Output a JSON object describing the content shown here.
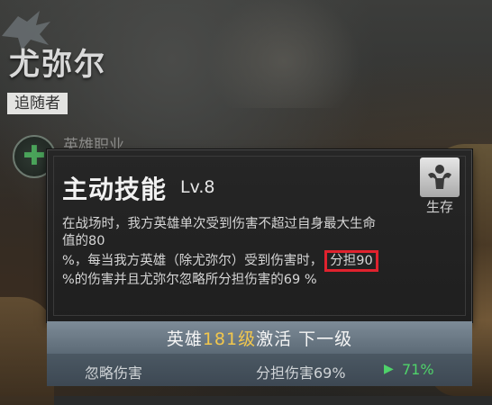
{
  "hero": {
    "name": "尤弥尔",
    "role": "追随者",
    "class_label": "英雄职业",
    "class_icon": "plus-icon"
  },
  "skill": {
    "title": "主动技能",
    "level": "Lv.8",
    "type_label": "生存",
    "type_icon": "muscle-icon",
    "description": {
      "line1": "在战场时，我方英雄单次受到伤害不超过自身最大生命",
      "line2": "值的80",
      "line3a": "%，每当我方英雄（除尤弥尔）受到伤害时，",
      "line3b": "分担90",
      "line4": "%的伤害并且尤弥尔忽略所分担伤害的69 %"
    }
  },
  "activation": {
    "prefix": "英雄",
    "level": "181级",
    "suffix": "激活 下一级"
  },
  "stats": {
    "left": "忽略伤害",
    "right": "分担伤害69%",
    "next_value": "71%"
  },
  "colors": {
    "highlight_border": "#e0222e",
    "level_gold": "#f2c74d",
    "increase_green": "#4fd36a"
  }
}
